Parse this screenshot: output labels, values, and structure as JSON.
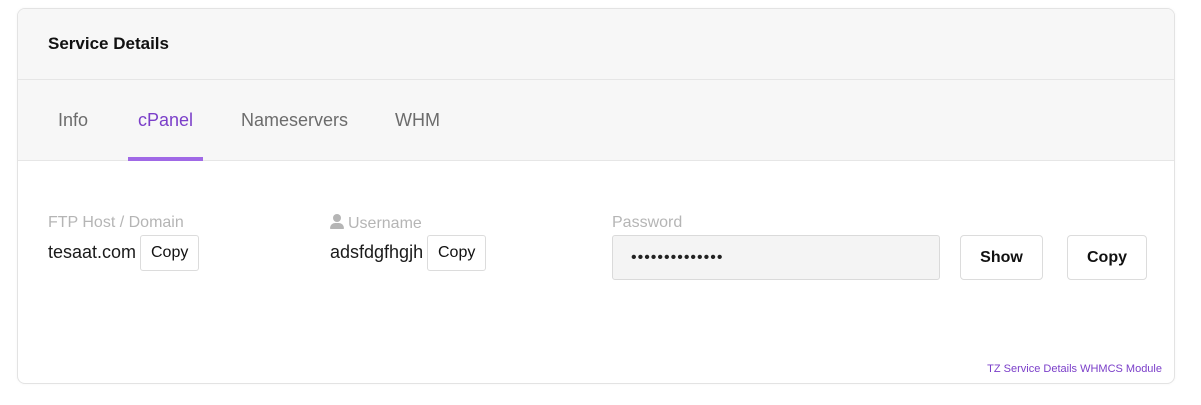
{
  "card": {
    "title": "Service Details"
  },
  "tabs": [
    {
      "label": "Info",
      "active": false
    },
    {
      "label": "cPanel",
      "active": true
    },
    {
      "label": "Nameservers",
      "active": false
    },
    {
      "label": "WHM",
      "active": false
    }
  ],
  "fields": {
    "ftp_host": {
      "label": "FTP Host / Domain",
      "value": "tesaat.com",
      "copy_label": "Copy"
    },
    "username": {
      "label": "Username",
      "icon": "user-icon",
      "value": "adsfdgfhgjh",
      "copy_label": "Copy"
    },
    "password": {
      "label": "Password",
      "value": "••••••••••••••",
      "show_label": "Show",
      "copy_label": "Copy"
    }
  },
  "footer": {
    "link_text": "TZ Service Details WHMCS Module"
  },
  "colors": {
    "accent": "#7b3fc9",
    "tab_underline": "#a069e6",
    "header_bg": "#f7f7f7",
    "label_gray": "#b5b5b5"
  }
}
